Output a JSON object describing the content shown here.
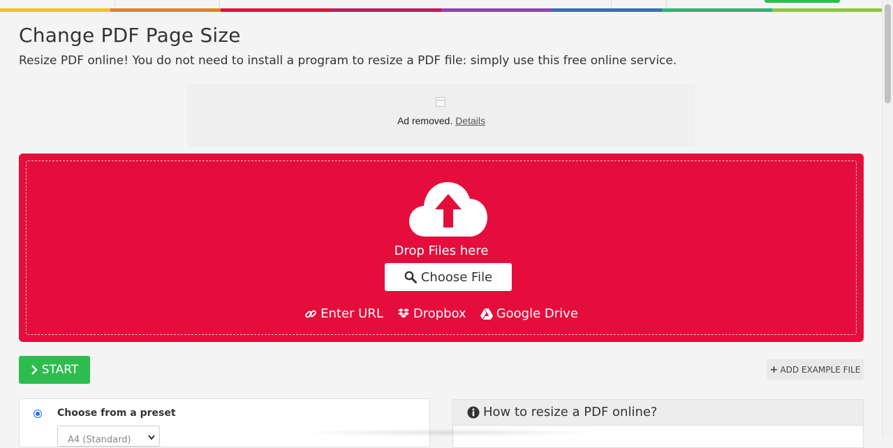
{
  "page": {
    "title": "Change PDF Page Size",
    "subtitle": "Resize PDF online! You do not need to install a program to resize a PDF file: simply use this free online service."
  },
  "colors": {
    "strip": [
      "#f0c419",
      "#ee7d22",
      "#e50d3c",
      "#c2185b",
      "#8e44ad",
      "#3a6db5",
      "#2bb673",
      "#8dc63f"
    ],
    "drop_zone": "#e50d3c",
    "start": "#2dbd4e",
    "radio": "#1a73e8"
  },
  "ad": {
    "removed_text": "Ad removed.",
    "details_link": "Details"
  },
  "upload": {
    "drop_label": "Drop Files here",
    "choose_file": "Choose File",
    "sources": [
      {
        "label": "Enter URL",
        "icon": "link-icon"
      },
      {
        "label": "Dropbox",
        "icon": "dropbox-icon"
      },
      {
        "label": "Google Drive",
        "icon": "google-drive-icon"
      }
    ]
  },
  "actions": {
    "start": "START",
    "add_example": "ADD EXAMPLE FILE"
  },
  "options": {
    "preset_label": "Choose from a preset",
    "preset_value": "A4 (Standard)"
  },
  "howto": {
    "title": "How to resize a PDF online?"
  }
}
